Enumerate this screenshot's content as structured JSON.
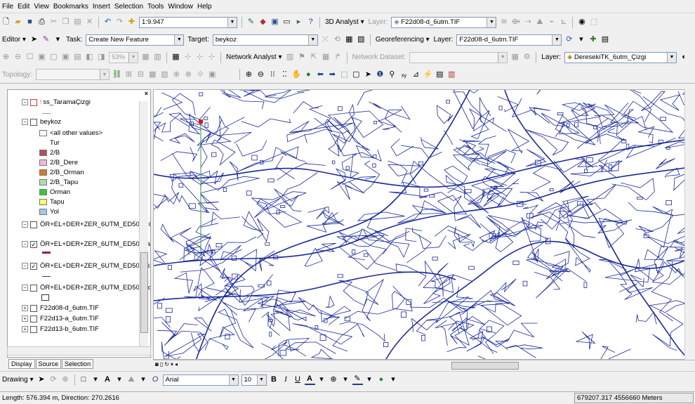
{
  "menu": [
    "File",
    "Edit",
    "View",
    "Bookmarks",
    "Insert",
    "Selection",
    "Tools",
    "Window",
    "Help"
  ],
  "standard_toolbar": {
    "scale": "1:9.947",
    "analyst_3d": "3D Analyst",
    "layer_label": "Layer:",
    "layer_value": "F22d08-d_6utm.TIF"
  },
  "editor_toolbar": {
    "editor": "Editor",
    "task_label": "Task:",
    "task_value": "Create New Feature",
    "target_label": "Target:",
    "target_value": "beykoz",
    "georef": "Georeferencing",
    "layer_label": "Layer:",
    "layer_value": "F22d08-d_6utm.TIF"
  },
  "network_toolbar": {
    "zoom_pct": "53%",
    "network_analyst": "Network Analyst",
    "dataset_label": "Network Dataset:",
    "layer_label": "Layer:",
    "layer_value": "DeresekiTK_6utm_Çizgi"
  },
  "topology_toolbar": {
    "topology_label": "Topology:"
  },
  "toc": {
    "layers": [
      {
        "name": "ss_TaramaÇizgi"
      },
      {
        "name": "beykoz"
      },
      {
        "name": "<all other values>"
      },
      {
        "name": "Tur"
      },
      {
        "name": "2/B",
        "color": "#b05060"
      },
      {
        "name": "2/B_Dere",
        "color": "#f0b8d8"
      },
      {
        "name": "2/B_Orman",
        "color": "#d87a2a"
      },
      {
        "name": "2/B_Tapu",
        "color": "#b4d8b4"
      },
      {
        "name": "Orman",
        "color": "#32cd32"
      },
      {
        "name": "Tapu",
        "color": "#ffff66"
      },
      {
        "name": "Yol",
        "color": "#9ec9f0"
      },
      {
        "name": "ÖR+EL+DER+ZER_6UTM_ED50_Münh"
      },
      {
        "name": "ÖR+EL+DER+ZER_6UTM_ED50_Taran"
      },
      {
        "name": "ÖR+EL+DER+ZER_6UTM_ED50_Çizgi"
      },
      {
        "name": "ÖR+EL+DER+ZER_6UTM_ED50_Çokg"
      },
      {
        "name": "F22d08-d_6utm.TIF"
      },
      {
        "name": "F22d13-a_6utm.TIF"
      },
      {
        "name": "F22d13-b_6utm.TIF"
      }
    ],
    "tabs": [
      "Display",
      "Source",
      "Selection"
    ]
  },
  "drawing_toolbar": {
    "drawing": "Drawing",
    "font": "Arial",
    "size": "10"
  },
  "status": {
    "length": "Length: 576.394 m, Direction: 270.2616",
    "coords": "679207.317 4556660 Meters"
  }
}
